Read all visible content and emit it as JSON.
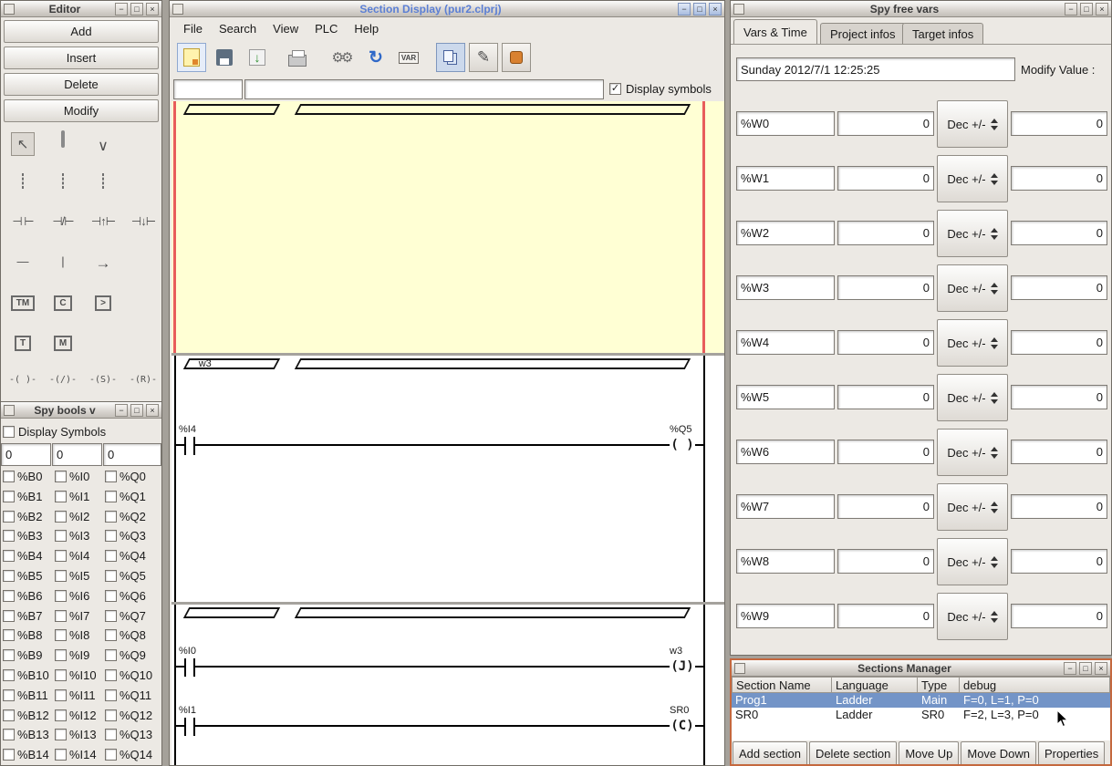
{
  "window_controls": {
    "minimize": "−",
    "maximize": "□",
    "close": "×"
  },
  "editor": {
    "title": "Editor",
    "buttons": [
      "Add",
      "Insert",
      "Delete",
      "Modify"
    ],
    "tools": {
      "pointer": "↖",
      "wire_v": "∨",
      "contact_open": "⊣ ⊢",
      "contact_closed": "⊣/⊢",
      "contact_rising": "⊣↑⊢",
      "contact_falling": "⊣↓⊢",
      "h_line": "—",
      "v_line": "|",
      "arrow": "→",
      "timer_block": "TM",
      "counter_block": "C",
      "compare_block": ">",
      "timer_old": "T",
      "monostable": "M",
      "coil": "-( )-",
      "coil_not": "-(/)-",
      "coil_set": "-(S)-",
      "coil_reset": "-(R)-"
    }
  },
  "spy_bools": {
    "title": "Spy bools v",
    "display_symbols_label": "Display Symbols",
    "offsets": [
      "0",
      "0",
      "0"
    ],
    "rows": [
      {
        "b": "%B0",
        "i": "%I0",
        "q": "%Q0"
      },
      {
        "b": "%B1",
        "i": "%I1",
        "q": "%Q1"
      },
      {
        "b": "%B2",
        "i": "%I2",
        "q": "%Q2"
      },
      {
        "b": "%B3",
        "i": "%I3",
        "q": "%Q3"
      },
      {
        "b": "%B4",
        "i": "%I4",
        "q": "%Q4"
      },
      {
        "b": "%B5",
        "i": "%I5",
        "q": "%Q5"
      },
      {
        "b": "%B6",
        "i": "%I6",
        "q": "%Q6"
      },
      {
        "b": "%B7",
        "i": "%I7",
        "q": "%Q7"
      },
      {
        "b": "%B8",
        "i": "%I8",
        "q": "%Q8"
      },
      {
        "b": "%B9",
        "i": "%I9",
        "q": "%Q9"
      },
      {
        "b": "%B10",
        "i": "%I10",
        "q": "%Q10"
      },
      {
        "b": "%B11",
        "i": "%I11",
        "q": "%Q11"
      },
      {
        "b": "%B12",
        "i": "%I12",
        "q": "%Q12"
      },
      {
        "b": "%B13",
        "i": "%I13",
        "q": "%Q13"
      },
      {
        "b": "%B14",
        "i": "%I14",
        "q": "%Q14"
      }
    ]
  },
  "section_display": {
    "title": "Section Display (pur2.clprj)",
    "menus": [
      "File",
      "Search",
      "View",
      "PLC",
      "Help"
    ],
    "toolbar": {
      "var_label": "VAR"
    },
    "search_value": "",
    "symbol_value": "",
    "display_symbols_label": "Display symbols",
    "display_symbols_checked": "✓",
    "ladder": {
      "section2_header": "w3",
      "rung1": {
        "contact_label": "%I4",
        "coil_label": "%Q5",
        "coil_symbol": "( )"
      },
      "rung2": {
        "contact_label": "%I0",
        "coil_label": "w3",
        "coil_symbol": "(J)"
      },
      "rung3": {
        "contact_label": "%I1",
        "coil_label": "SR0",
        "coil_symbol": "(C)"
      }
    }
  },
  "spy_free_vars": {
    "title": "Spy free vars",
    "tabs": [
      "Vars & Time",
      "Project infos",
      "Target infos"
    ],
    "datetime": "Sunday 2012/7/1 12:25:25",
    "modify_value_label": "Modify Value :",
    "rows": [
      {
        "name": "%W0",
        "value": "0",
        "mode": "Dec +/-",
        "modify": "0"
      },
      {
        "name": "%W1",
        "value": "0",
        "mode": "Dec +/-",
        "modify": "0"
      },
      {
        "name": "%W2",
        "value": "0",
        "mode": "Dec +/-",
        "modify": "0"
      },
      {
        "name": "%W3",
        "value": "0",
        "mode": "Dec +/-",
        "modify": "0"
      },
      {
        "name": "%W4",
        "value": "0",
        "mode": "Dec +/-",
        "modify": "0"
      },
      {
        "name": "%W5",
        "value": "0",
        "mode": "Dec +/-",
        "modify": "0"
      },
      {
        "name": "%W6",
        "value": "0",
        "mode": "Dec +/-",
        "modify": "0"
      },
      {
        "name": "%W7",
        "value": "0",
        "mode": "Dec +/-",
        "modify": "0"
      },
      {
        "name": "%W8",
        "value": "0",
        "mode": "Dec +/-",
        "modify": "0"
      },
      {
        "name": "%W9",
        "value": "0",
        "mode": "Dec +/-",
        "modify": "0"
      }
    ]
  },
  "sections_manager": {
    "title": "Sections Manager",
    "headers": [
      "Section Name",
      "Language",
      "Type",
      "debug"
    ],
    "rows": [
      {
        "name": "Prog1",
        "language": "Ladder",
        "type": "Main",
        "debug": "F=0, L=1, P=0"
      },
      {
        "name": "SR0",
        "language": "Ladder",
        "type": "SR0",
        "debug": "F=2, L=3, P=0"
      }
    ],
    "buttons": [
      "Add section",
      "Delete section",
      "Move Up",
      "Move Down",
      "Properties"
    ]
  }
}
